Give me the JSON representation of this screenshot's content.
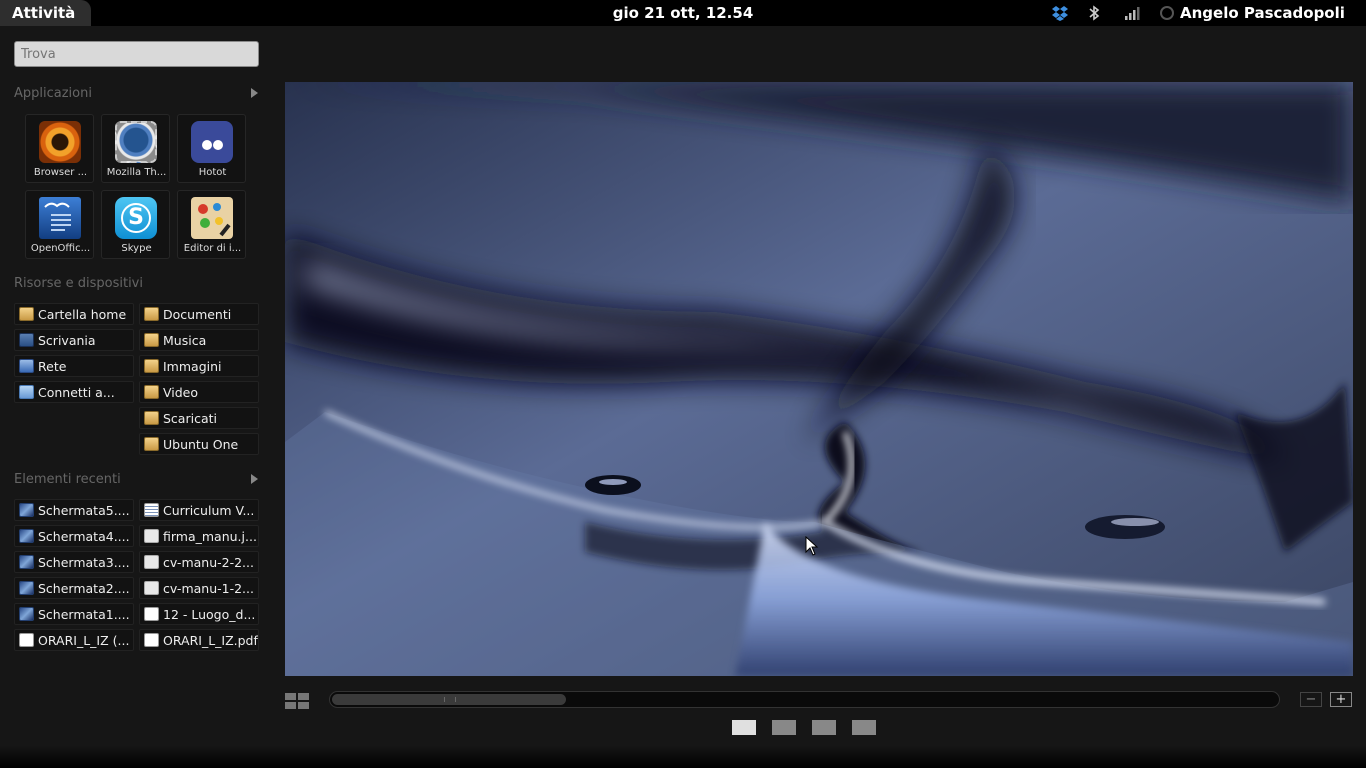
{
  "top_panel": {
    "activities_label": "Attività",
    "clock": "gio 21 ott, 12.54",
    "tray_icons": [
      "dropbox-icon",
      "bluetooth-icon",
      "network-signal-icon"
    ],
    "user_name": "Angelo Pascadopoli"
  },
  "search": {
    "placeholder": "Trova"
  },
  "applications": {
    "title": "Applicazioni",
    "items": [
      {
        "label": "Browser ...",
        "icon": "browser-icon"
      },
      {
        "label": "Mozilla Th...",
        "icon": "thunderbird-icon"
      },
      {
        "label": "Hotot",
        "icon": "hotot-icon"
      },
      {
        "label": "OpenOffic...",
        "icon": "openoffice-icon"
      },
      {
        "label": "Skype",
        "icon": "skype-icon"
      },
      {
        "label": "Editor di i...",
        "icon": "image-editor-icon"
      }
    ]
  },
  "places": {
    "title": "Risorse e dispositivi",
    "left": [
      {
        "label": "Cartella home",
        "icon": "home-folder-icon"
      },
      {
        "label": "Scrivania",
        "icon": "desktop-icon"
      },
      {
        "label": "Rete",
        "icon": "network-icon"
      },
      {
        "label": "Connetti a...",
        "icon": "connect-server-icon"
      }
    ],
    "right": [
      {
        "label": "Documenti",
        "icon": "documents-folder-icon"
      },
      {
        "label": "Musica",
        "icon": "music-folder-icon"
      },
      {
        "label": "Immagini",
        "icon": "pictures-folder-icon"
      },
      {
        "label": "Video",
        "icon": "videos-folder-icon"
      },
      {
        "label": "Scaricati",
        "icon": "downloads-folder-icon"
      },
      {
        "label": "Ubuntu One",
        "icon": "ubuntu-one-folder-icon"
      }
    ]
  },
  "recent": {
    "title": "Elementi recenti",
    "left": [
      {
        "label": "Schermata5....",
        "icon": "screenshot-icon"
      },
      {
        "label": "Schermata4....",
        "icon": "screenshot-icon"
      },
      {
        "label": "Schermata3....",
        "icon": "screenshot-icon"
      },
      {
        "label": "Schermata2....",
        "icon": "screenshot-icon"
      },
      {
        "label": "Schermata1....",
        "icon": "screenshot-icon"
      },
      {
        "label": "ORARI_L_IZ (...",
        "icon": "document-icon"
      }
    ],
    "right": [
      {
        "label": "Curriculum V...",
        "icon": "text-document-icon"
      },
      {
        "label": "firma_manu.j...",
        "icon": "image-file-icon"
      },
      {
        "label": "cv-manu-2-2...",
        "icon": "image-file-icon"
      },
      {
        "label": "cv-manu-1-2...",
        "icon": "image-file-icon"
      },
      {
        "label": "12 - Luogo_d...",
        "icon": "document-icon"
      },
      {
        "label": "ORARI_L_IZ.pdf",
        "icon": "pdf-document-icon"
      }
    ]
  },
  "workspace": {
    "zoom_out_label": "−",
    "zoom_in_label": "+",
    "workspace_count": 4,
    "active_workspace": 1
  }
}
